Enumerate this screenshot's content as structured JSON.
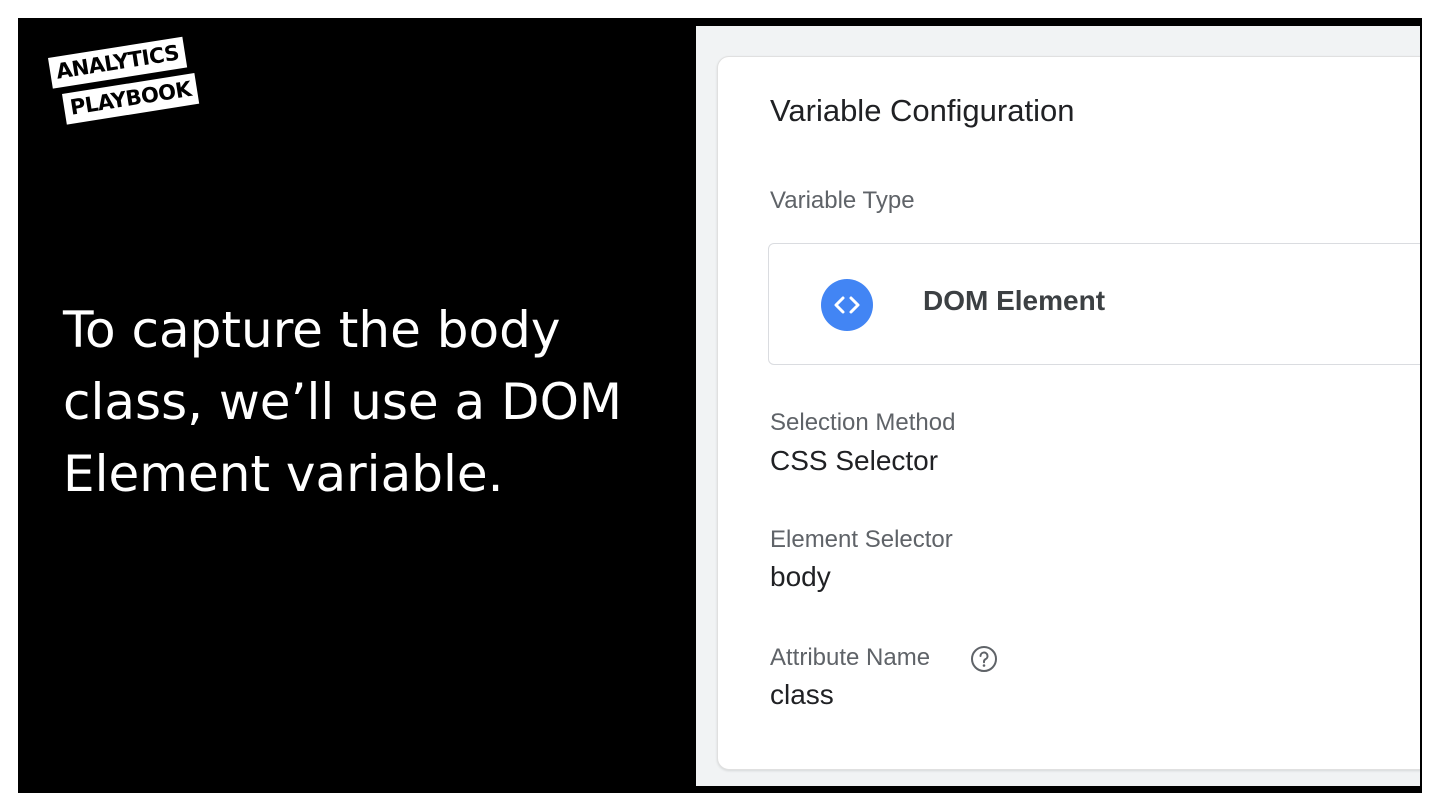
{
  "logo": {
    "line1": "ANALYTICS",
    "line2": "PLAYBOOK"
  },
  "headline": "To capture the body class, we’ll use a DOM Element variable.",
  "config": {
    "title": "Variable Configuration",
    "variable_type_label": "Variable Type",
    "variable_type_value": "DOM Element",
    "variable_type_icon": "code-brackets-icon",
    "selection_method_label": "Selection Method",
    "selection_method_value": "CSS Selector",
    "element_selector_label": "Element Selector",
    "element_selector_value": "body",
    "attribute_name_label": "Attribute Name",
    "attribute_name_help_icon": "help-circle-icon",
    "attribute_name_value": "class"
  },
  "colors": {
    "slide_bg": "#000000",
    "panel_bg": "#f1f3f4",
    "icon_blue": "#4285f4",
    "label_gray": "#5f6368",
    "text_dark": "#202124"
  }
}
